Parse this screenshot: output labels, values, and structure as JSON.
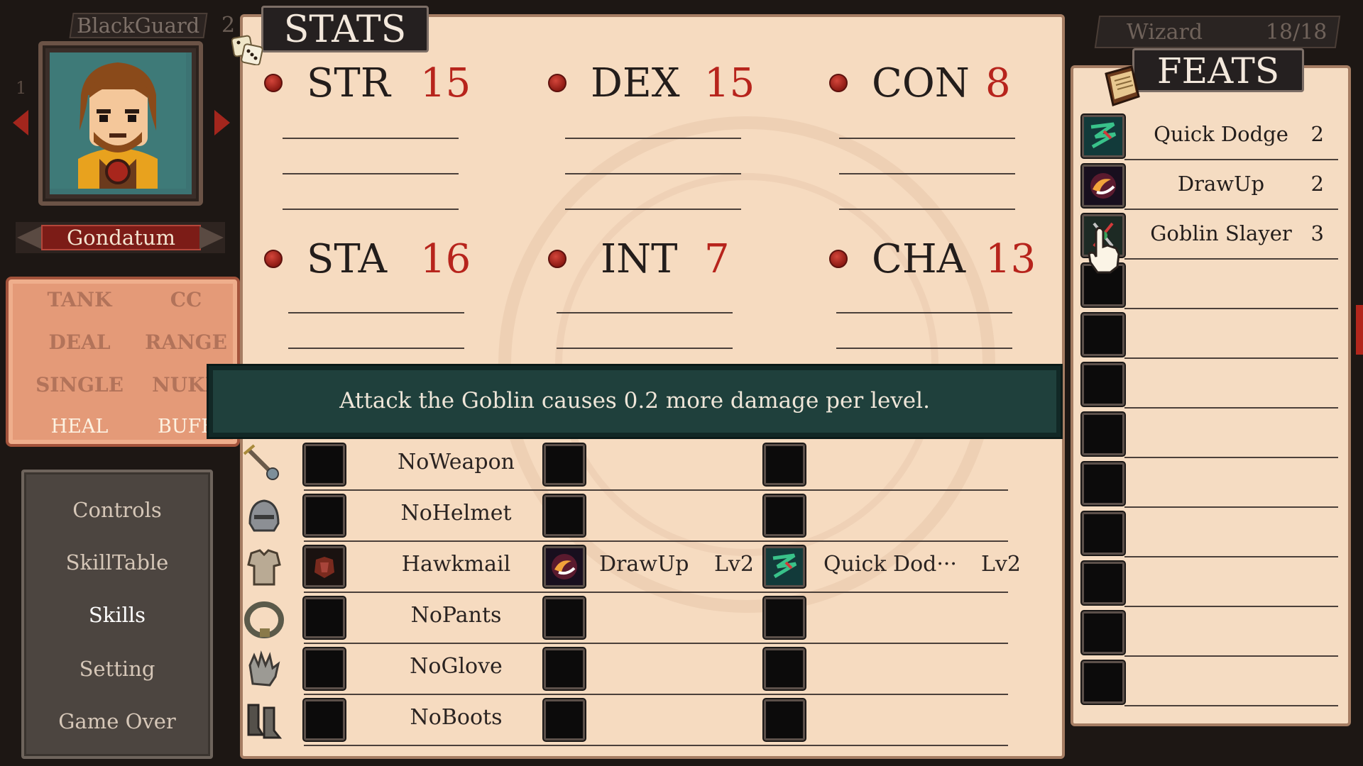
{
  "character": {
    "class_header": "BlackGuard",
    "page_num": "2",
    "side_digit": "1",
    "name": "Gondatum"
  },
  "roles": [
    {
      "label": "TANK",
      "active": false
    },
    {
      "label": "CC",
      "active": false
    },
    {
      "label": "DEAL",
      "active": false
    },
    {
      "label": "RANGE",
      "active": false
    },
    {
      "label": "SINGLE",
      "active": false
    },
    {
      "label": "NUKE",
      "active": false
    },
    {
      "label": "HEAL",
      "active": true
    },
    {
      "label": "BUFF",
      "active": true
    }
  ],
  "menu": [
    {
      "label": "Controls"
    },
    {
      "label": "SkillTable"
    },
    {
      "label": "Skills",
      "active": true
    },
    {
      "label": "Setting"
    },
    {
      "label": "Game Over"
    }
  ],
  "stats": {
    "title": "STATS",
    "items": [
      {
        "name": "STR",
        "value": "15"
      },
      {
        "name": "DEX",
        "value": "15"
      },
      {
        "name": "CON",
        "value": "8"
      },
      {
        "name": "STA",
        "value": "16"
      },
      {
        "name": "INT",
        "value": "7"
      },
      {
        "name": "CHA",
        "value": "13"
      }
    ]
  },
  "tooltip": "Attack the Goblin causes 0.2 more damage per level.",
  "equipment": [
    {
      "name": "NoWeapon",
      "icon": "weapon-icon",
      "feat1": "",
      "feat1_lv": "",
      "feat2": "",
      "feat2_lv": ""
    },
    {
      "name": "NoHelmet",
      "icon": "helmet-icon",
      "feat1": "",
      "feat1_lv": "",
      "feat2": "",
      "feat2_lv": ""
    },
    {
      "name": "Hawkmail",
      "icon": "armor-icon",
      "feat1": "DrawUp",
      "feat1_lv": "Lv2",
      "feat2": "Quick Dod···",
      "feat2_lv": "Lv2"
    },
    {
      "name": "NoPants",
      "icon": "belt-icon",
      "feat1": "",
      "feat1_lv": "",
      "feat2": "",
      "feat2_lv": ""
    },
    {
      "name": "NoGlove",
      "icon": "glove-icon",
      "feat1": "",
      "feat1_lv": "",
      "feat2": "",
      "feat2_lv": ""
    },
    {
      "name": "NoBoots",
      "icon": "boots-icon",
      "feat1": "",
      "feat1_lv": "",
      "feat2": "",
      "feat2_lv": ""
    }
  ],
  "feats": {
    "class_name": "Wizard",
    "count": "18/18",
    "title": "FEATS",
    "items": [
      {
        "name": "Quick Dodge",
        "level": "2",
        "icon": "quick-dodge-icon"
      },
      {
        "name": "DrawUp",
        "level": "2",
        "icon": "drawup-icon"
      },
      {
        "name": "Goblin Slayer",
        "level": "3",
        "icon": "goblin-slayer-icon"
      },
      {
        "name": "",
        "level": ""
      },
      {
        "name": "",
        "level": ""
      },
      {
        "name": "",
        "level": ""
      },
      {
        "name": "",
        "level": ""
      },
      {
        "name": "",
        "level": ""
      },
      {
        "name": "",
        "level": ""
      },
      {
        "name": "",
        "level": ""
      },
      {
        "name": "",
        "level": ""
      },
      {
        "name": "",
        "level": ""
      }
    ]
  },
  "colors": {
    "accent_red": "#b7241c",
    "board_bg": "#f6dbc0",
    "tooltip_bg": "#1f403c"
  }
}
